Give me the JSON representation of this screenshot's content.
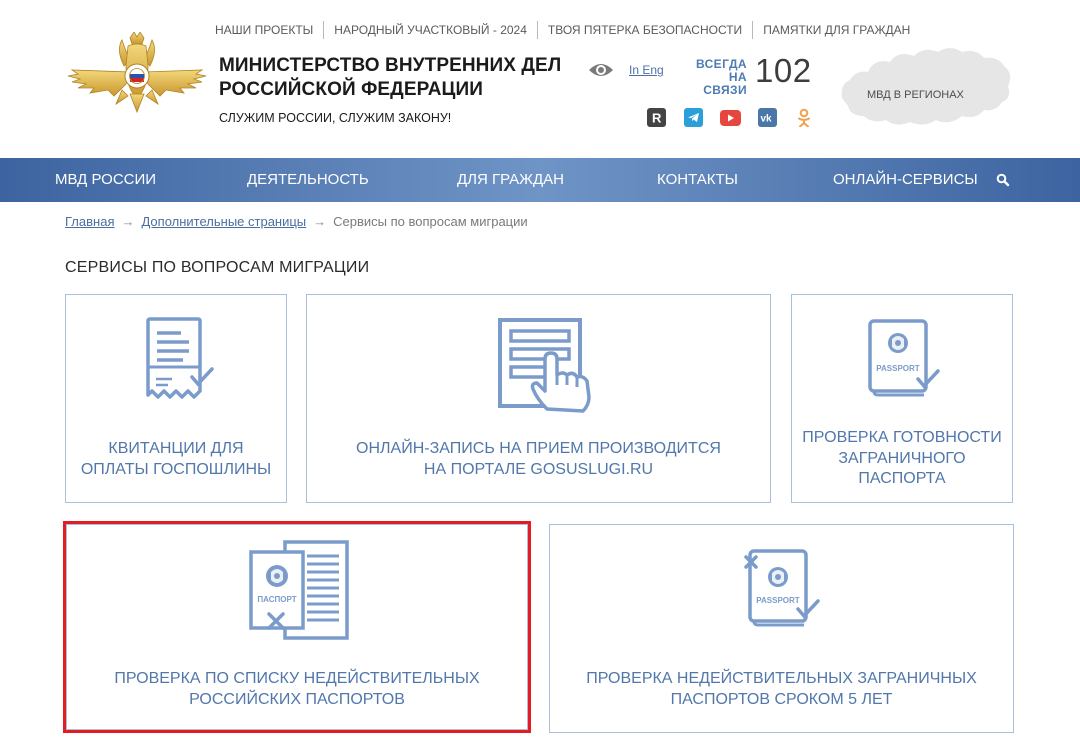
{
  "top_links": [
    "НАШИ ПРОЕКТЫ",
    "НАРОДНЫЙ УЧАСТКОВЫЙ - 2024",
    "ТВОЯ ПЯТЕРКА БЕЗОПАСНОСТИ",
    "ПАМЯТКИ ДЛЯ ГРАЖДАН"
  ],
  "header": {
    "title_line1": "МИНИСТЕРСТВО ВНУТРЕННИХ ДЕЛ",
    "title_line2": "РОССИЙСКОЙ ФЕДЕРАЦИИ",
    "motto": "СЛУЖИМ РОССИИ, СЛУЖИМ ЗАКОНУ!",
    "lang_link": "In Eng",
    "always_line1": "ВСЕГДА",
    "always_line2": "НА СВЯЗИ",
    "hotline": "102",
    "regions": "МВД В РЕГИОНАХ",
    "social": [
      "rutube-icon",
      "telegram-icon",
      "youtube-icon",
      "vk-icon",
      "odnoklassniki-icon"
    ]
  },
  "nav": {
    "items": [
      "МВД РОССИИ",
      "ДЕЯТЕЛЬНОСТЬ",
      "ДЛЯ ГРАЖДАН",
      "КОНТАКТЫ",
      "ОНЛАЙН-СЕРВИСЫ"
    ]
  },
  "breadcrumb": {
    "items": [
      "Главная",
      "Дополнительные страницы",
      "Сервисы по вопросам миграции"
    ],
    "separator": "→"
  },
  "page_title": "СЕРВИСЫ ПО ВОПРОСАМ МИГРАЦИИ",
  "cards": [
    {
      "line1": "КВИТАНЦИИ ДЛЯ",
      "line2": "ОПЛАТЫ ГОСПОШЛИНЫ",
      "icon": "receipt-icon"
    },
    {
      "line1": "ОНЛАЙН-ЗАПИСЬ НА ПРИЕМ ПРОИЗВОДИТСЯ",
      "line2": "НА ПОРТАЛЕ GOSUSLUGI.RU",
      "icon": "online-booking-icon"
    },
    {
      "line1": "Проверка готовности",
      "line2": "заграничного",
      "line3": "паспорта",
      "icon": "passport-check-icon",
      "icon_text": "PASSPORT"
    },
    {
      "line1": "ПРОВЕРКА ПО СПИСКУ НЕДЕЙСТВИТЕЛЬНЫХ",
      "line2": "РОССИЙСКИХ ПАСПОРТОВ",
      "icon": "invalid-passport-list-icon",
      "icon_text": "ПАСПОРТ"
    },
    {
      "line1": "ПРОВЕРКА НЕДЕЙСТВИТЕЛЬНЫХ ЗАГРАНИЧНЫХ",
      "line2": "ПАСПОРТОВ СРОКОМ 5 ЛЕТ",
      "icon": "invalid-foreign-passport-icon",
      "icon_text": "PASSPORT"
    }
  ],
  "colors": {
    "accent": "#5177ab",
    "nav": "#4a72aa",
    "highlight": "#e31b23",
    "card_border": "#a9c0da"
  }
}
